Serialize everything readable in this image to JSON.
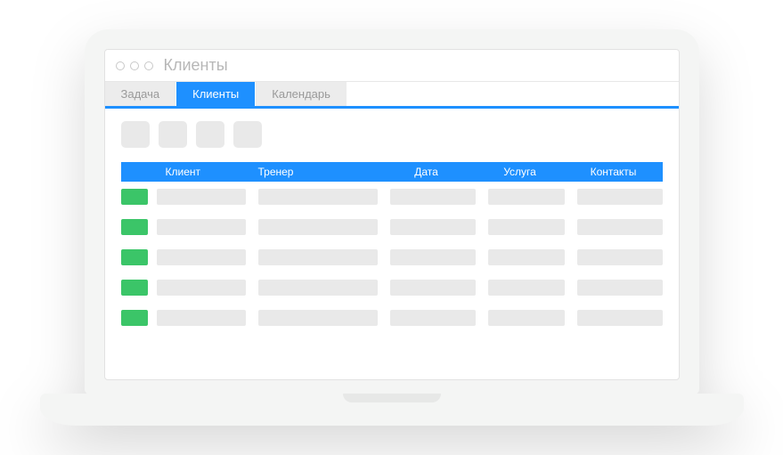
{
  "window": {
    "title": "Клиенты"
  },
  "tabs": [
    {
      "label": "Задача",
      "active": false
    },
    {
      "label": "Клиенты",
      "active": true
    },
    {
      "label": "Календарь",
      "active": false
    }
  ],
  "toolbar": {
    "buttons": [
      "",
      "",
      "",
      ""
    ]
  },
  "table": {
    "columns": {
      "status": "",
      "client": "Клиент",
      "trainer": "Тренер",
      "date": "Дата",
      "service": "Услуга",
      "contact": "Контакты"
    },
    "rows": [
      {
        "status": "green",
        "client": "",
        "trainer": "",
        "date": "",
        "service": "",
        "contact": ""
      },
      {
        "status": "green",
        "client": "",
        "trainer": "",
        "date": "",
        "service": "",
        "contact": ""
      },
      {
        "status": "green",
        "client": "",
        "trainer": "",
        "date": "",
        "service": "",
        "contact": ""
      },
      {
        "status": "green",
        "client": "",
        "trainer": "",
        "date": "",
        "service": "",
        "contact": ""
      },
      {
        "status": "green",
        "client": "",
        "trainer": "",
        "date": "",
        "service": "",
        "contact": ""
      }
    ]
  },
  "colors": {
    "accent": "#1e90ff",
    "status_ok": "#3bc568",
    "placeholder": "#e9e9e9"
  }
}
